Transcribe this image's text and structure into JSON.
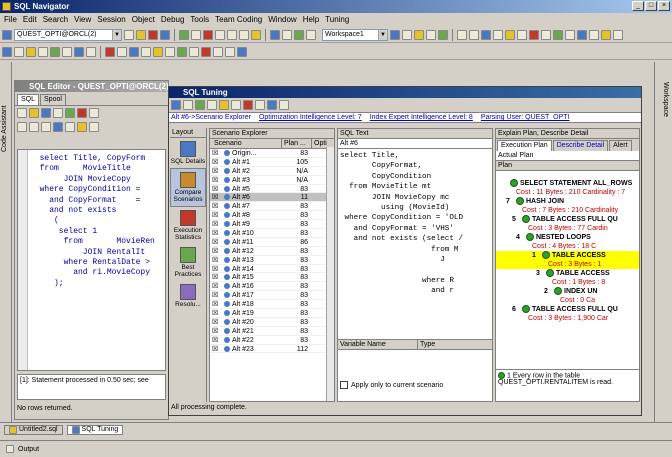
{
  "app": {
    "title": "SQL Navigator"
  },
  "menu": [
    "File",
    "Edit",
    "Search",
    "View",
    "Session",
    "Object",
    "Debug",
    "Tools",
    "Team Coding",
    "Window",
    "Help",
    "Tuning"
  ],
  "toolbar": {
    "session": "QUEST_OPTI@ORCL(2)",
    "workspace": "Workspace1",
    "conn": "QUEST_OPTI"
  },
  "side_tabs": {
    "left": "Code Assistant",
    "right": "Workspace"
  },
  "editor": {
    "title": "SQL Editor - QUEST_OPTI@ORCL(2)",
    "tabs": [
      "SQL",
      "Spool"
    ],
    "lines": [
      "  select Title, CopyForm",
      "  from     MovieTitle",
      "       JOIN MovieCopy",
      "  where CopyCondition =",
      "    and CopyFormat    =",
      "    and not exists",
      "     (",
      "      select 1",
      "       from       MovieRen",
      "           JOIN RentalIt",
      "       where RentalDate >",
      "         and ri.MovieCopy",
      "     );"
    ],
    "message": "[1]: Statement processed in 0.50 sec; see",
    "status": "No rows returned."
  },
  "tuning": {
    "title": "SQL Tuning",
    "breadcrumb": "Alt #6->Scenario Explorer",
    "oi_level": "Optimization Intelligence Level: 7",
    "ie_level": "Index Expert Intelligence Level: 8",
    "parsing_user": "Parsing User: QUEST_OPTI",
    "layout_label": "Layout",
    "layout_items": [
      "SQL Details",
      "Compare Scenarios",
      "Execution Statistics",
      "Best Practices",
      "Resolu..."
    ],
    "scenario_title": "Scenario Explorer",
    "scenario_cols": [
      "Scenario",
      "Plan ...",
      "Opti"
    ],
    "scenarios": [
      {
        "name": "Origin...",
        "plan": "83"
      },
      {
        "name": "Alt #1",
        "plan": "105"
      },
      {
        "name": "Alt #2",
        "plan": "N/A"
      },
      {
        "name": "Alt #3",
        "plan": "N/A"
      },
      {
        "name": "Alt #5",
        "plan": "83"
      },
      {
        "name": "Alt #6",
        "plan": "11"
      },
      {
        "name": "Alt #7",
        "plan": "83"
      },
      {
        "name": "Alt #8",
        "plan": "83"
      },
      {
        "name": "Alt #9",
        "plan": "83"
      },
      {
        "name": "Alt #10",
        "plan": "83"
      },
      {
        "name": "Alt #11",
        "plan": "86"
      },
      {
        "name": "Alt #12",
        "plan": "83"
      },
      {
        "name": "Alt #13",
        "plan": "83"
      },
      {
        "name": "Alt #14",
        "plan": "83"
      },
      {
        "name": "Alt #15",
        "plan": "83"
      },
      {
        "name": "Alt #16",
        "plan": "83"
      },
      {
        "name": "Alt #17",
        "plan": "83"
      },
      {
        "name": "Alt #18",
        "plan": "83"
      },
      {
        "name": "Alt #19",
        "plan": "83"
      },
      {
        "name": "Alt #20",
        "plan": "83"
      },
      {
        "name": "Alt #21",
        "plan": "83"
      },
      {
        "name": "Alt #22",
        "plan": "83"
      },
      {
        "name": "Alt #23",
        "plan": "112"
      }
    ],
    "sqltext_title": "SQL Text",
    "sqltext_sub": "Alt #6",
    "sqltext_lines": [
      "select Title,",
      "       CopyFormat,",
      "       CopyCondition",
      "  from MovieTitle mt",
      "       JOIN MovieCopy mc",
      "         using (MovieId)",
      " where CopyCondition = 'OLD",
      "   and CopyFormat = 'VHS'",
      "   and not exists (select /",
      "                    from M",
      "                      J",
      "",
      "                  where R",
      "                    and r"
    ],
    "var_cols": [
      "Variable Name",
      "Type"
    ],
    "apply_label": "Apply only to current scenario",
    "plan_title": "Explain Plan, Describe Detail",
    "plan_tabs": [
      "Execution Plan",
      "Describe Detail",
      "Alert"
    ],
    "actual_plan": "Actual Plan",
    "plan_col": "Plan",
    "plan_nodes": [
      {
        "id": "",
        "label": "SELECT STATEMENT  ALL_ROWS",
        "cost": "Cost : 11 Bytes : 210 Cardinality : 7"
      },
      {
        "id": "7",
        "label": "HASH JOIN",
        "cost": "Cost : 7 Bytes : 210 Cardinality"
      },
      {
        "id": "5",
        "label": "TABLE ACCESS FULL QU",
        "cost": "Cost : 3 Bytes : 77 Cardin"
      },
      {
        "id": "4",
        "label": "NESTED LOOPS",
        "cost": "Cost : 4 Bytes : 18 C"
      },
      {
        "id": "1",
        "label": "TABLE ACCESS",
        "cost": "Cost : 3 Bytes : 1"
      },
      {
        "id": "3",
        "label": "TABLE ACCESS",
        "cost": "Cost : 1 Bytes : 8"
      },
      {
        "id": "2",
        "label": "INDEX UN",
        "cost": "Cost : 0 Ca"
      },
      {
        "id": "6",
        "label": "TABLE ACCESS FULL QU",
        "cost": "Cost : 3 Bytes : 1,900 Car"
      }
    ],
    "plan_note_num": "1",
    "plan_note": "Every row in the table QUEST_OPTI.RENTALITEM is read.",
    "status": "All processing complete."
  },
  "taskbar": {
    "items": [
      "Untitled2.sql",
      "SQL Tuning"
    ],
    "output": "Output"
  },
  "colors": {
    "title": "#0a246a",
    "highlight": "#ffff00",
    "cost": "#c00000"
  }
}
